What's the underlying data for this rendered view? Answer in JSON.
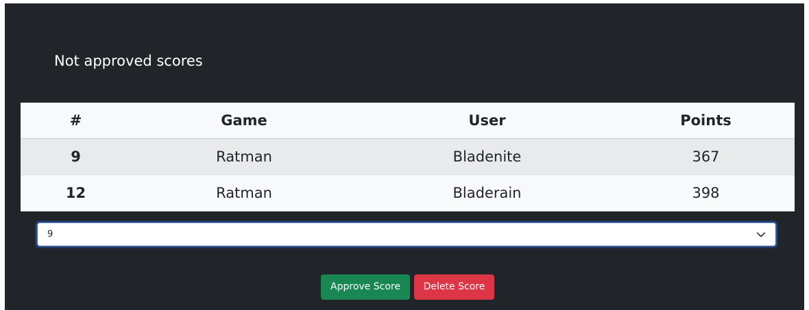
{
  "page": {
    "heading": "Not approved scores"
  },
  "table": {
    "columns": [
      "#",
      "Game",
      "User",
      "Points"
    ],
    "rows": [
      {
        "id": "9",
        "game": "Ratman",
        "user": "Bladenite",
        "points": "367"
      },
      {
        "id": "12",
        "game": "Ratman",
        "user": "Bladerain",
        "points": "398"
      }
    ]
  },
  "select": {
    "value": "9",
    "icon": "chevron-down-icon"
  },
  "buttons": {
    "approve_label": "Approve Score",
    "delete_label": "Delete Score"
  },
  "colors": {
    "panel_bg": "#212529",
    "approve": "#198754",
    "delete": "#dc3545",
    "focus_border": "#3d5f9d"
  }
}
